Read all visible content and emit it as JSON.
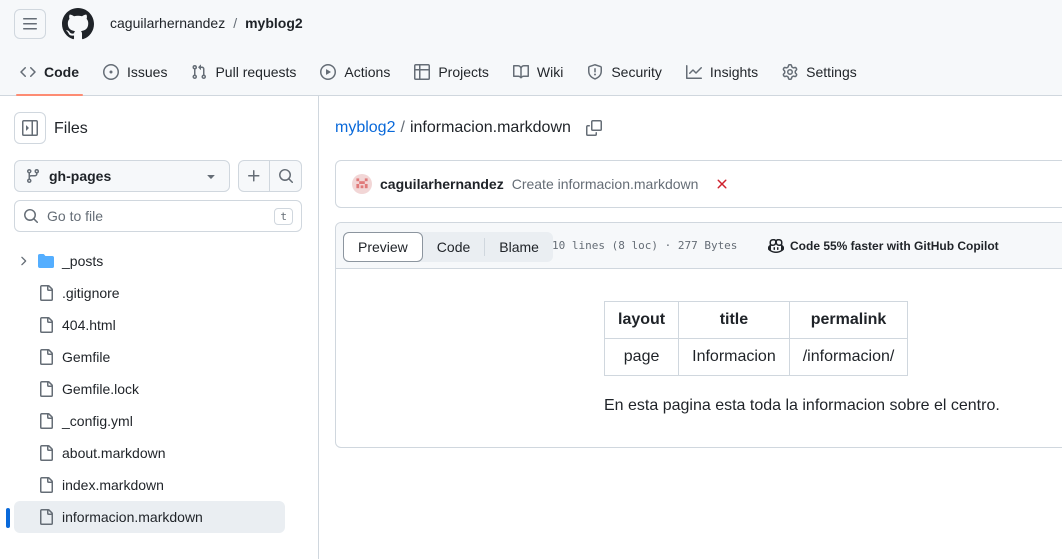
{
  "header": {
    "owner": "caguilarhernandez",
    "separator": "/",
    "repo": "myblog2"
  },
  "tabs": [
    {
      "label": "Code",
      "icon": "code-icon",
      "active": true
    },
    {
      "label": "Issues",
      "icon": "issue-icon"
    },
    {
      "label": "Pull requests",
      "icon": "pull-request-icon"
    },
    {
      "label": "Actions",
      "icon": "play-icon"
    },
    {
      "label": "Projects",
      "icon": "table-icon"
    },
    {
      "label": "Wiki",
      "icon": "book-icon"
    },
    {
      "label": "Security",
      "icon": "shield-icon"
    },
    {
      "label": "Insights",
      "icon": "graph-icon"
    },
    {
      "label": "Settings",
      "icon": "gear-icon"
    }
  ],
  "sidebar": {
    "title": "Files",
    "branch": "gh-pages",
    "goto_placeholder": "Go to file",
    "goto_shortcut": "t",
    "items": [
      {
        "label": "_posts",
        "type": "folder"
      },
      {
        "label": ".gitignore",
        "type": "file"
      },
      {
        "label": "404.html",
        "type": "file"
      },
      {
        "label": "Gemfile",
        "type": "file"
      },
      {
        "label": "Gemfile.lock",
        "type": "file"
      },
      {
        "label": "_config.yml",
        "type": "file"
      },
      {
        "label": "about.markdown",
        "type": "file"
      },
      {
        "label": "index.markdown",
        "type": "file"
      },
      {
        "label": "informacion.markdown",
        "type": "file",
        "selected": true
      }
    ]
  },
  "breadcrumb": {
    "repo": "myblog2",
    "separator": "/",
    "file": "informacion.markdown"
  },
  "commit": {
    "author": "caguilarhernandez",
    "message": "Create informacion.markdown",
    "status": "failed"
  },
  "file_view": {
    "views": [
      "Preview",
      "Code",
      "Blame"
    ],
    "active_view": "Preview",
    "info": "10 lines (8 loc) · 277 Bytes",
    "copilot_text": "Code 55% faster with GitHub Copilot"
  },
  "preview": {
    "table": {
      "headers": [
        "layout",
        "title",
        "permalink"
      ],
      "rows": [
        [
          "page",
          "Informacion",
          "/informacion/"
        ]
      ]
    },
    "paragraph": "En esta pagina esta toda la informacion sobre el centro."
  },
  "colors": {
    "accent": "#0969da",
    "tab_underline": "#fd8c73",
    "error": "#cf222e",
    "folder": "#54aeff"
  }
}
